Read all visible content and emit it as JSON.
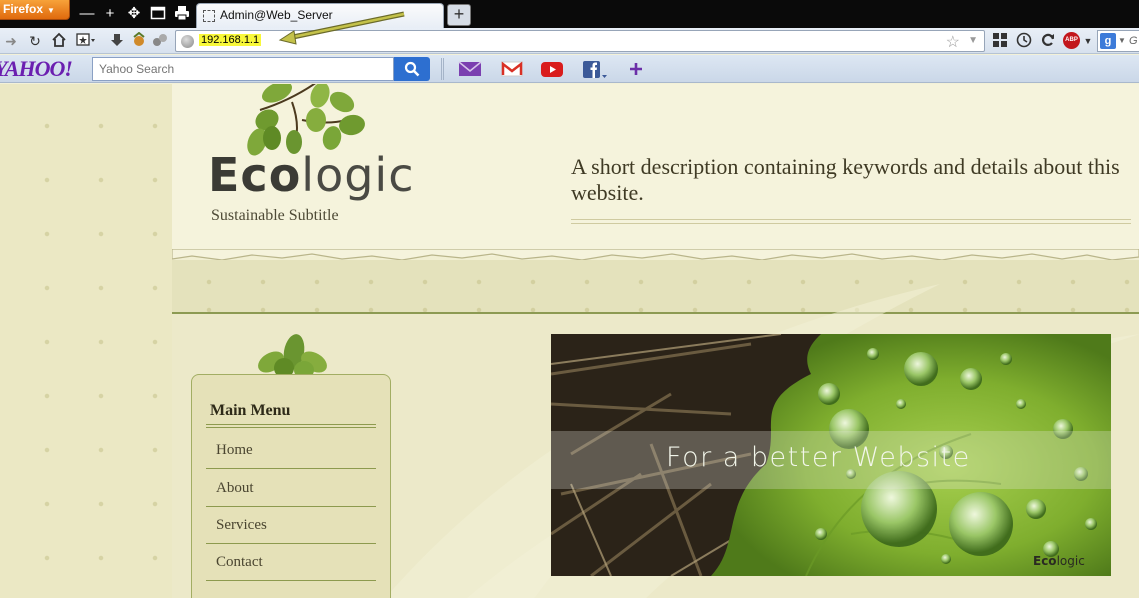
{
  "browser": {
    "menu_button": "Firefox",
    "tab_title": "Admin@Web_Server",
    "url": "192.168.1.1",
    "search_engine_hint": "G"
  },
  "toolbar": {
    "yahoo_logo": "YAHOO!",
    "search_placeholder": "Yahoo Search",
    "icons": [
      "mail-icon",
      "gmail-icon",
      "youtube-icon",
      "facebook-icon",
      "plus-icon"
    ]
  },
  "site": {
    "logo_bold": "Eco",
    "logo_light": "logic",
    "subtitle": "Sustainable Subtitle",
    "description": "A short description containing keywords and details about this website.",
    "menu": {
      "title": "Main Menu",
      "items": [
        "Home",
        "About",
        "Services",
        "Contact"
      ]
    },
    "banner": {
      "caption": "For a better Website",
      "watermark_bold": "Eco",
      "watermark_light": "logic"
    }
  },
  "colors": {
    "accent_green": "#8c9a52",
    "firefox_orange": "#e06a0d",
    "yahoo_purple": "#6b1fb0",
    "url_highlight": "#f8f83a"
  }
}
